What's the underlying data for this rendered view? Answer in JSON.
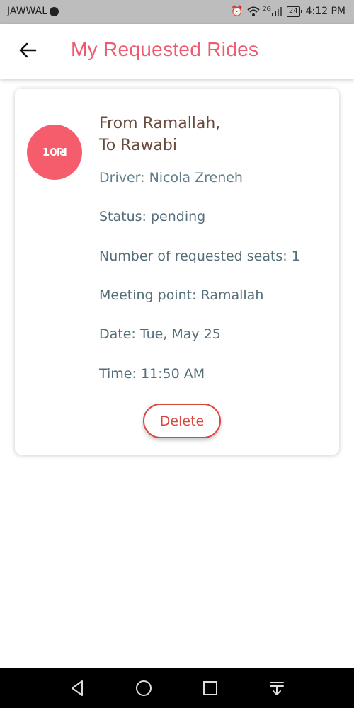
{
  "status_bar": {
    "carrier": "JAWWAL",
    "signal_label": "2G",
    "battery": "24",
    "time": "4:12 PM"
  },
  "app_bar": {
    "title": "My Requested Rides"
  },
  "ride": {
    "price": "10₪",
    "from": "From Ramallah,",
    "to": "To Rawabi",
    "driver": "Driver: Nicola Zreneh",
    "status": "Status: pending",
    "seats": "Number of requested seats: 1",
    "meeting_point": "Meeting point: Ramallah",
    "date": "Date: Tue, May 25",
    "time": "Time: 11:50 AM",
    "delete_label": "Delete"
  },
  "colors": {
    "title": "#ee5a6f",
    "price_badge": "#f55c6c",
    "delete": "#d9473e"
  },
  "icons": {
    "back": "arrow-left-icon",
    "nav_back": "triangle-back-icon",
    "nav_home": "circle-home-icon",
    "nav_recents": "square-recents-icon",
    "nav_notifications": "pull-down-icon"
  }
}
